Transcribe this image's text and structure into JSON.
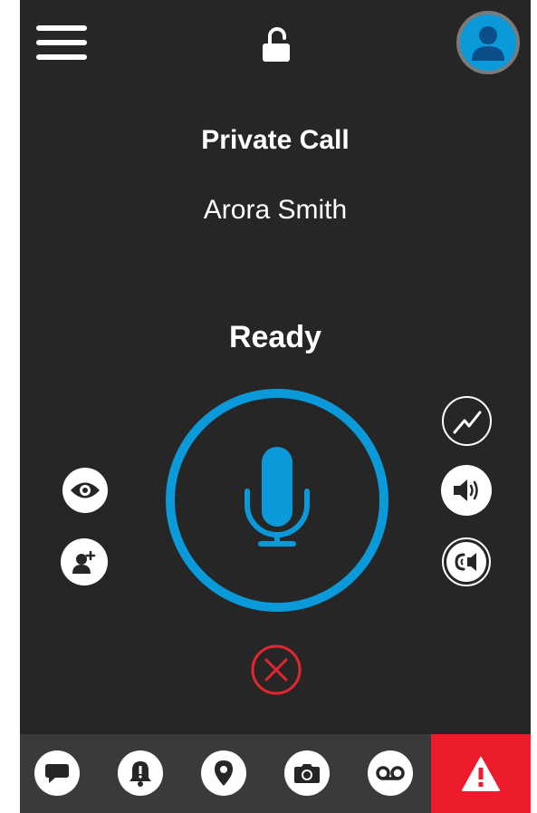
{
  "header": {
    "menu_icon": "hamburger-menu-icon",
    "lock_icon": "unlocked-padlock-icon",
    "avatar_icon": "user-avatar-icon"
  },
  "call": {
    "type_label": "Private Call",
    "contact_name": "Arora Smith",
    "status": "Ready"
  },
  "controls": {
    "ptt_icon": "microphone-icon",
    "end_call_icon": "close-x-icon",
    "left": [
      "eye-icon",
      "add-user-icon"
    ],
    "right": [
      "activity-trend-icon",
      "speaker-volume-icon",
      "earpiece-icon"
    ]
  },
  "bottom_nav": {
    "items": [
      "message-icon",
      "alert-bell-icon",
      "location-pin-icon",
      "camera-icon",
      "voicemail-icon"
    ],
    "emergency_icon": "warning-triangle-icon"
  },
  "colors": {
    "background": "#262626",
    "accent_blue": "#0a9ad9",
    "end_red": "#e3262f",
    "emergency_red": "#ed1c2c",
    "nav_bar": "#3a3a3a"
  }
}
